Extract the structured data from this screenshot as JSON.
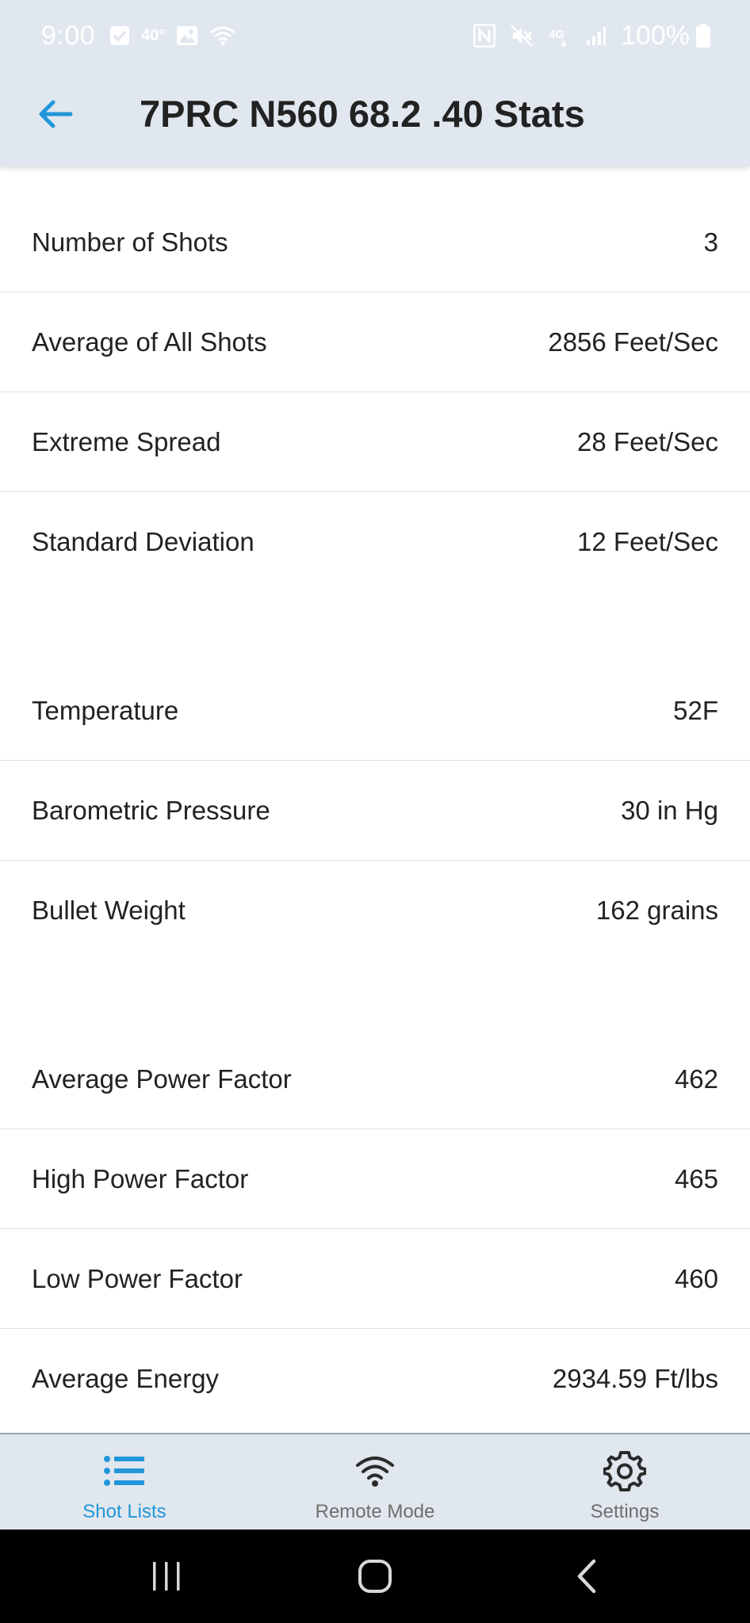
{
  "status_bar": {
    "time": "9:00",
    "temperature": "40°",
    "battery": "100%",
    "icons_left": [
      "check-box-icon",
      "image-icon",
      "wifi-icon"
    ],
    "icons_right": [
      "nfc-icon",
      "mute-icon",
      "4g-icon",
      "signal-icon",
      "battery-icon"
    ]
  },
  "header": {
    "title": "7PRC N560 68.2 .40 Stats",
    "back_icon": "arrow-left-icon",
    "accent_color": "#2196d9"
  },
  "stats": {
    "group1": [
      {
        "label": "Number of Shots",
        "value": "3"
      },
      {
        "label": "Average of All Shots",
        "value": "2856 Feet/Sec"
      },
      {
        "label": "Extreme Spread",
        "value": "28 Feet/Sec"
      },
      {
        "label": "Standard Deviation",
        "value": "12 Feet/Sec"
      }
    ],
    "group2": [
      {
        "label": "Temperature",
        "value": "52F"
      },
      {
        "label": "Barometric Pressure",
        "value": "30 in Hg"
      },
      {
        "label": "Bullet Weight",
        "value": "162 grains"
      }
    ],
    "group3": [
      {
        "label": "Average Power Factor",
        "value": "462"
      },
      {
        "label": "High Power Factor",
        "value": "465"
      },
      {
        "label": "Low Power Factor",
        "value": "460"
      },
      {
        "label": "Average Energy",
        "value": "2934.59 Ft/lbs"
      }
    ]
  },
  "bottom_nav": {
    "items": [
      {
        "label": "Shot Lists",
        "icon": "list-icon",
        "active": true
      },
      {
        "label": "Remote Mode",
        "icon": "wifi-icon",
        "active": false
      },
      {
        "label": "Settings",
        "icon": "gear-icon",
        "active": false
      }
    ]
  },
  "system_nav": {
    "buttons": [
      "recent-apps-icon",
      "home-icon",
      "back-icon"
    ]
  }
}
